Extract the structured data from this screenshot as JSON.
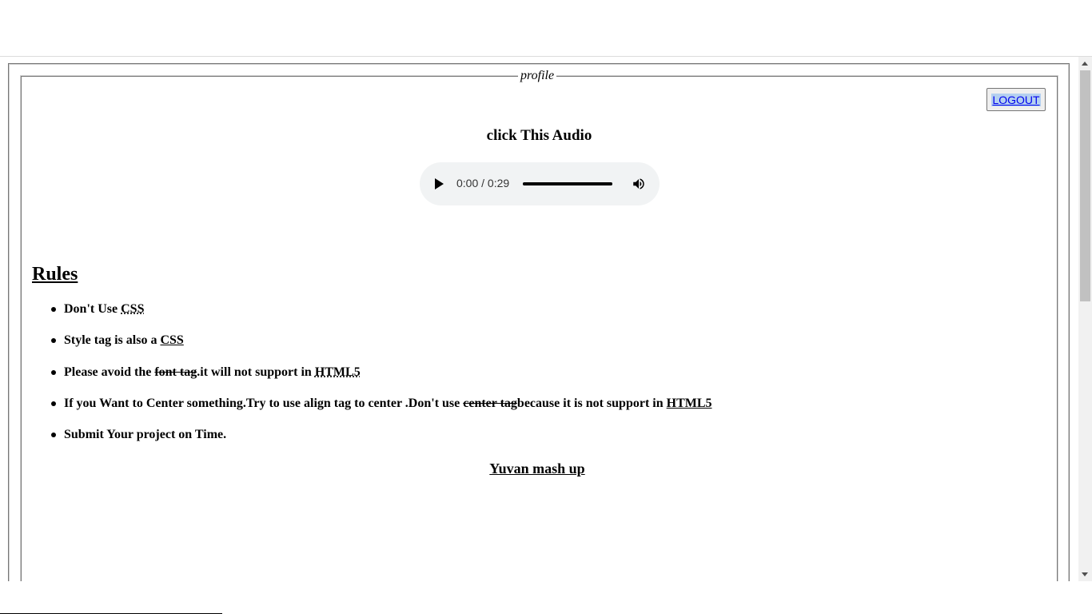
{
  "fieldset": {
    "legend": "profile"
  },
  "header": {
    "logout_label": "LOGOUT"
  },
  "audio": {
    "title": "click This Audio",
    "time": "0:00 / 0:29",
    "progress": 1.0
  },
  "rules": {
    "heading": "Rules",
    "items": [
      {
        "prefix": "Don't Use ",
        "abbr": "CSS"
      },
      {
        "prefix": "Style tag is also a ",
        "link": "CSS"
      },
      {
        "prefix": "Please avoid the ",
        "strike": "font tag",
        "suffix": ".it will not support in ",
        "abbr": "HTML5"
      },
      {
        "prefix": "If you Want to Center something.Try to use align tag to center .Don't use ",
        "strike": "center tag",
        "suffix": "because it is not support in ",
        "link": "HTML5"
      },
      {
        "prefix": "Submit Your project on Time."
      }
    ]
  },
  "footer": {
    "mashup_label": "Yuvan mash up"
  },
  "icons": {
    "play": "play-icon",
    "volume": "volume-icon",
    "scroll_up": "chevron-up-icon",
    "scroll_down": "chevron-down-icon"
  },
  "colors": {
    "link": "#0000ee",
    "selection": "#b4d0f0",
    "player_bg": "#f1f3f4"
  }
}
